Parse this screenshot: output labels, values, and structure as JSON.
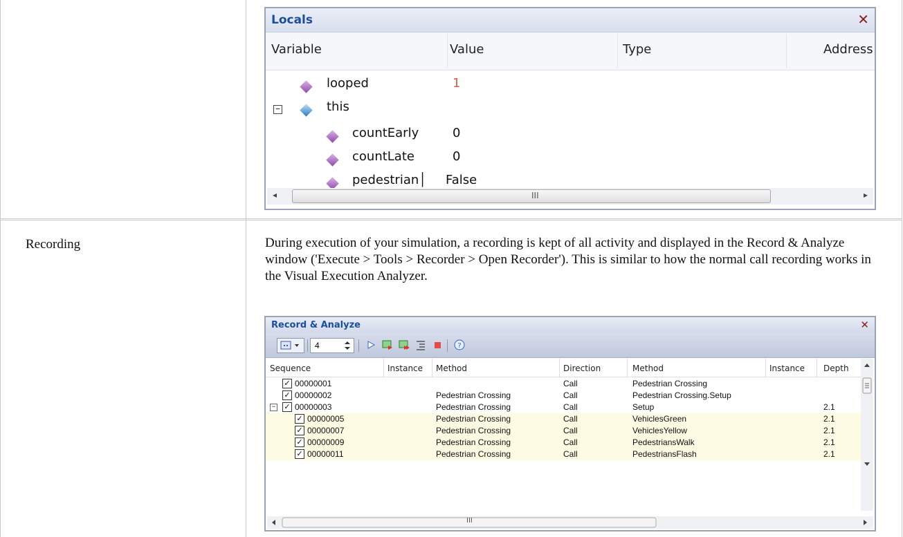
{
  "doc": {
    "row2_label": "Recording",
    "row2_paragraph": "During execution of your simulation, a recording is kept of all activity and displayed in the Record & Analyze window ('Execute > Tools > Recorder > Open Recorder'). This is similar to how the normal call recording works in the Visual Execution Analyzer."
  },
  "locals": {
    "title": "Locals",
    "close_glyph": "✕",
    "columns": [
      "Variable",
      "Value",
      "Type",
      "Address"
    ],
    "rows": [
      {
        "name": "looped",
        "value": "1",
        "icon": "purple-member-icon",
        "changed": true
      },
      {
        "name": "this",
        "value": "",
        "icon": "blue-object-icon",
        "expander": "−"
      },
      {
        "name": "countEarly",
        "value": "0",
        "icon": "purple-member-icon"
      },
      {
        "name": "countLate",
        "value": "0",
        "icon": "purple-member-icon"
      },
      {
        "name": "pedestrian│",
        "value": "False",
        "icon": "purple-member-icon"
      }
    ],
    "hscroll_left": "◂",
    "hscroll_right": "▸",
    "hscroll_grip": "III"
  },
  "recorder": {
    "title": "Record & Analyze",
    "close_glyph": "✕",
    "depth_value": "4",
    "columns": [
      "Sequence",
      "Instance",
      "Method",
      "Direction",
      "Method",
      "Instance",
      "Depth"
    ],
    "rows": [
      {
        "seq": "00000001",
        "inst1": "",
        "method1": "",
        "direction": "Call",
        "method2": "Pedestrian Crossing",
        "inst2": "",
        "depth": "",
        "indent": 1,
        "highlight": false
      },
      {
        "seq": "00000002",
        "inst1": "",
        "method1": "Pedestrian Crossing",
        "direction": "Call",
        "method2": "Pedestrian Crossing.Setup",
        "inst2": "",
        "depth": "",
        "indent": 1,
        "highlight": false
      },
      {
        "seq": "00000003",
        "inst1": "",
        "method1": "Pedestrian Crossing",
        "direction": "Call",
        "method2": "Setup",
        "inst2": "",
        "depth": "2.1",
        "indent": 1,
        "highlight": false,
        "expander": "−"
      },
      {
        "seq": "00000005",
        "inst1": "",
        "method1": "Pedestrian Crossing",
        "direction": "Call",
        "method2": "VehiclesGreen",
        "inst2": "",
        "depth": "2.1",
        "indent": 2,
        "highlight": true
      },
      {
        "seq": "00000007",
        "inst1": "",
        "method1": "Pedestrian Crossing",
        "direction": "Call",
        "method2": "VehiclesYellow",
        "inst2": "",
        "depth": "2.1",
        "indent": 2,
        "highlight": true
      },
      {
        "seq": "00000009",
        "inst1": "",
        "method1": "Pedestrian Crossing",
        "direction": "Call",
        "method2": "PedestriansWalk",
        "inst2": "",
        "depth": "2.1",
        "indent": 2,
        "highlight": true
      },
      {
        "seq": "00000011",
        "inst1": "",
        "method1": "Pedestrian Crossing",
        "direction": "Call",
        "method2": "PedestriansFlash",
        "inst2": "",
        "depth": "2.1",
        "indent": 2,
        "highlight": true
      }
    ],
    "check_glyph": "✓",
    "hscroll_grip": "III"
  }
}
